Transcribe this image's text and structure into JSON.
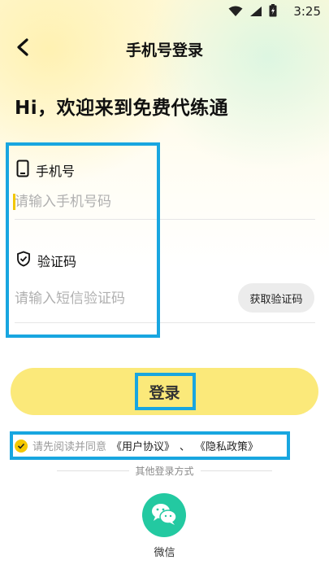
{
  "status_bar": {
    "time": "3:25",
    "icons": [
      "wifi-icon",
      "signal-icon",
      "battery-charging-icon"
    ]
  },
  "header": {
    "title": "手机号登录",
    "back_icon": "chevron-left-icon"
  },
  "welcome_text": "Hi，欢迎来到免费代练通",
  "phone_field": {
    "label": "手机号",
    "placeholder": "请输入手机号码",
    "value": "",
    "icon": "phone-icon"
  },
  "code_field": {
    "label": "验证码",
    "placeholder": "请输入短信验证码",
    "value": "",
    "icon": "shield-check-icon"
  },
  "get_code_button": "获取验证码",
  "login_button": "登录",
  "agreement": {
    "prefix": "请先阅读并同意",
    "user_agreement": "《用户协议》",
    "separator": "、",
    "privacy_policy": "《隐私政策》",
    "checked": true
  },
  "other_login": {
    "label": "其他登录方式",
    "wechat_label": "微信",
    "wechat_icon": "wechat-icon"
  },
  "colors": {
    "accent_yellow": "#fbe97a",
    "checkbox_yellow": "#f5c800",
    "wechat_green": "#23c9a1",
    "highlight_blue": "#18a6e0"
  }
}
